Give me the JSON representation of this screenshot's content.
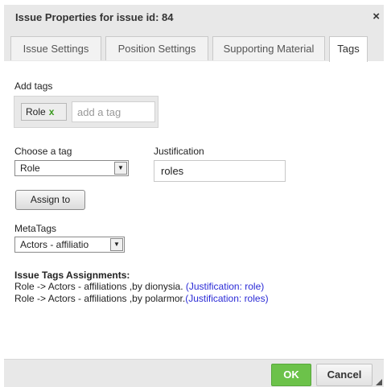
{
  "dialog": {
    "title": "Issue Properties for issue id: 84",
    "close_symbol": "×"
  },
  "tabs": [
    {
      "label": "Issue Settings",
      "active": false
    },
    {
      "label": "Position Settings",
      "active": false
    },
    {
      "label": "Supporting Material",
      "active": false
    },
    {
      "label": "Tags",
      "active": true
    }
  ],
  "add_tags": {
    "label": "Add tags",
    "chips": [
      {
        "label": "Role",
        "remove_symbol": "x"
      }
    ],
    "input_placeholder": "add a tag"
  },
  "choose_tag": {
    "label": "Choose a tag",
    "selected": "Role"
  },
  "justification": {
    "label": "Justification",
    "value": "roles"
  },
  "assign_button": "Assign to",
  "metatags": {
    "label": "MetaTags",
    "selected": "Actors - affiliatio"
  },
  "assignments": {
    "heading": "Issue Tags Assignments:",
    "items": [
      {
        "text": "Role -> Actors - affiliations ,by dionysia. ",
        "justification": "(Justification: role)"
      },
      {
        "text": "Role -> Actors - affiliations ,by polarmor.",
        "justification": "(Justification: roles)"
      }
    ]
  },
  "footer": {
    "ok_label": "OK",
    "cancel_label": "Cancel"
  },
  "colors": {
    "ok_button": "#6cc24a",
    "justification_link": "#2a2ad6",
    "tag_remove": "#3a9a1e"
  },
  "icons": {
    "close": "close-icon",
    "dropdown": "chevron-down-icon",
    "resize": "resize-grip-icon"
  }
}
